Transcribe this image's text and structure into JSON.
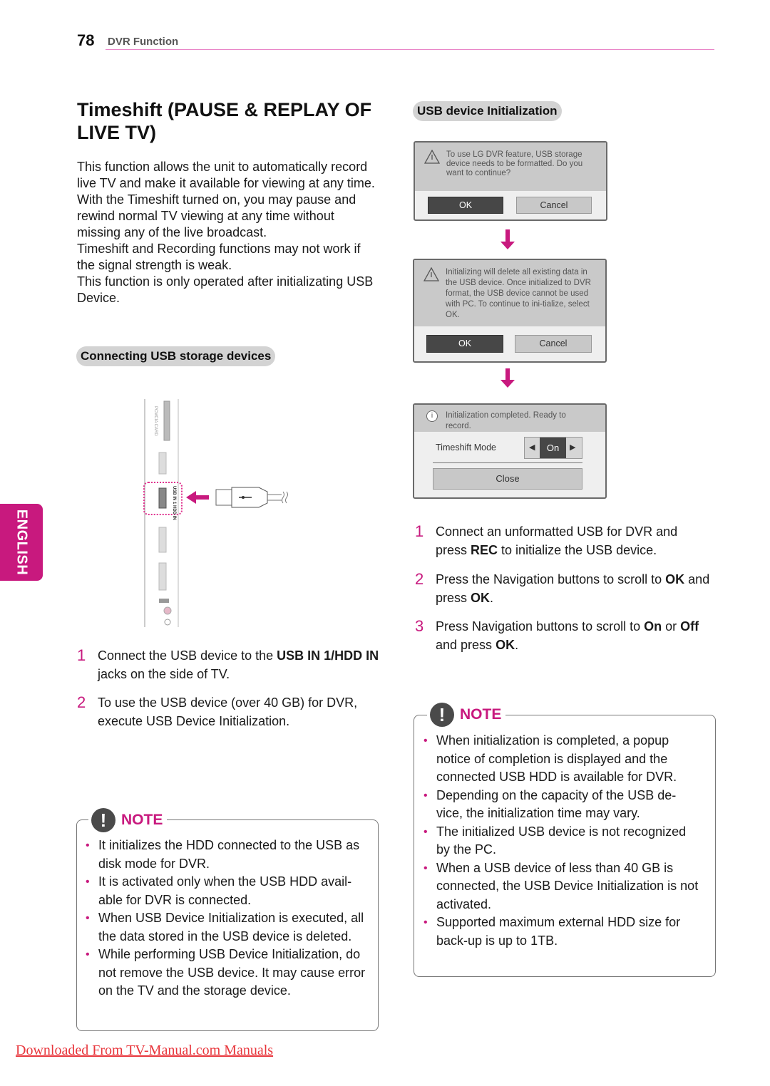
{
  "header": {
    "page_number": "78",
    "section": "DVR Function"
  },
  "language_tab": "ENGLISH",
  "title": "Timeshift (PAUSE & REPLAY OF LIVE TV)",
  "intro_paragraphs": [
    "This function allows the unit to automatically record live TV and make it available for viewing at any time.",
    "With the Timeshift turned on, you may pause and rewind normal TV viewing at any time without missing any of the live broadcast.",
    "Timeshift and Recording functions may not work if the signal strength is weak.",
    "This function is only operated after initializating USB Device."
  ],
  "connecting": {
    "heading": "Connecting USB storage devices",
    "image": {
      "port_label": "USB IN 1 HDD IN",
      "arrow_color": "#c8197e",
      "icon": "usb-plug-icon"
    },
    "steps": [
      {
        "num": "1",
        "pre": "Connect the USB device to the ",
        "bold": "USB IN 1/HDD IN",
        "post": " jacks on the side of TV."
      },
      {
        "num": "2",
        "text": "To use the USB device (over 40 GB) for DVR, execute USB Device Initialization."
      }
    ],
    "note": {
      "label": "NOTE",
      "items": [
        "It initializes the HDD connected to the USB as disk mode for DVR.",
        "It is activated only when the USB HDD avail-able for DVR is connected.",
        "When USB Device Initialization is executed, all the data stored in the USB device is deleted.",
        "While performing USB Device Initialization, do not remove the USB device. It may cause error on the TV and the storage device."
      ]
    }
  },
  "initialization": {
    "heading": "USB device Initialization",
    "dialog1": {
      "message": "To use LG DVR feature, USB storage device needs to be formatted. Do you want to continue?",
      "ok": "OK",
      "cancel": "Cancel"
    },
    "dialog2": {
      "message": "Initializing will delete all existing data in the USB device. Once initialized to DVR format, the USB device cannot be used with PC. To continue to ini-tialize, select OK.",
      "ok": "OK",
      "cancel": "Cancel"
    },
    "dialog3": {
      "message": "Initialization completed. Ready to record.",
      "mode_label": "Timeshift Mode",
      "mode_value": "On",
      "close": "Close"
    },
    "steps": [
      {
        "num": "1",
        "segments": [
          [
            "Connect an unformatted USB for DVR and press ",
            false
          ],
          [
            "REC",
            true
          ],
          [
            " to initialize the USB device.",
            false
          ]
        ]
      },
      {
        "num": "2",
        "segments": [
          [
            "Press the Navigation buttons to scroll to ",
            false
          ],
          [
            "OK",
            true
          ],
          [
            " and press ",
            false
          ],
          [
            "OK",
            true
          ],
          [
            ".",
            false
          ]
        ]
      },
      {
        "num": "3",
        "segments": [
          [
            "Press Navigation buttons to scroll to ",
            false
          ],
          [
            "On",
            true
          ],
          [
            " or ",
            false
          ],
          [
            "Off",
            true
          ],
          [
            " and press ",
            false
          ],
          [
            "OK",
            true
          ],
          [
            ".",
            false
          ]
        ]
      }
    ],
    "note": {
      "label": "NOTE",
      "items": [
        "When initialization is completed, a popup notice of completion is displayed and the connected USB HDD is available for DVR.",
        "Depending on the capacity of the USB de-vice, the initialization time may vary.",
        "The initialized USB device is not recognized by the PC.",
        "When a USB device of less than 40 GB is connected, the USB Device Initialization is not activated.",
        "Supported maximum external HDD size for back-up is up to 1TB."
      ]
    }
  },
  "footer_link": "Downloaded From TV-Manual.com Manuals",
  "colors": {
    "accent": "#c8197e",
    "link": "#e8353b",
    "header_rule": "#e986c8"
  }
}
